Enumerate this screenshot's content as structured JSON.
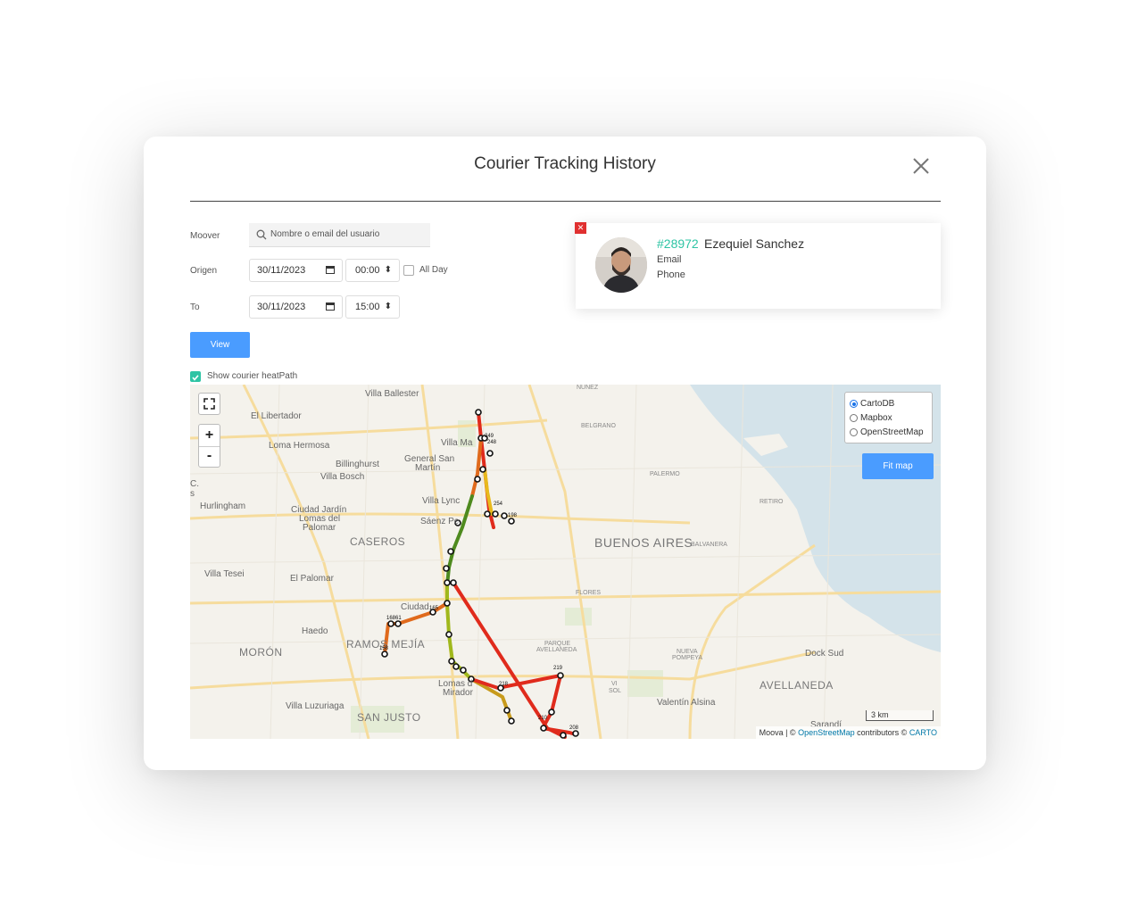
{
  "modal": {
    "title": "Courier Tracking History"
  },
  "form": {
    "moover_label": "Moover",
    "moover_placeholder": "Nombre o email del usuario",
    "origen_label": "Origen",
    "origen_date": "30/11/2023",
    "origen_time": "00:00",
    "all_day_label": "All Day",
    "to_label": "To",
    "to_date": "30/11/2023",
    "to_time": "15:00",
    "view_button": "View",
    "heatpath_label": "Show courier heatPath",
    "heatpath_checked": true
  },
  "courier": {
    "id": "#28972",
    "name": "Ezequiel Sanchez",
    "email": "Email",
    "phone": "Phone"
  },
  "map": {
    "zoom_in": "+",
    "zoom_out": "-",
    "layers": [
      "CartoDB",
      "Mapbox",
      "OpenStreetMap"
    ],
    "selected_layer": "CartoDB",
    "fit_button": "Fit map",
    "scale": "3 km",
    "attribution": {
      "prefix": "Moova | ©",
      "osm": "OpenStreetMap",
      "middle": "contributors ©",
      "carto": "CARTO"
    },
    "places": {
      "villa_ballester": "Villa Ballester",
      "nunez": "NUÑEZ",
      "el_libertador": "El Libertador",
      "belgrano": "BELGRANO",
      "loma_hermosa": "Loma Hermosa",
      "villa_maipu": "Villa Ma",
      "general_san_martin_1": "General San",
      "general_san_martin_2": "Martín",
      "billinghurst": "Billinghurst",
      "villa_bosch": "Villa Bosch",
      "palermo": "PALERMO",
      "hurlingham": "Hurlingham",
      "ciudad_jardin_1": "Ciudad Jardín",
      "ciudad_jardin_2": "Lomas del",
      "ciudad_jardin_3": "Palomar",
      "villa_lynch": "Villa Lync",
      "saenz_pena": "Sáenz Pe",
      "retiro": "RETIRO",
      "caseros": "CASEROS",
      "buenos_aires": "BUENOS AIRES",
      "balvanera": "BALVANERA",
      "villa_tesei": "Villa Tesei",
      "el_palomar": "El Palomar",
      "flores": "FLORES",
      "ciudad": "Ciudad",
      "haedo": "Haedo",
      "ramos_mejia": "RAMOS MEJÍA",
      "moron": "MORÓN",
      "parque_avellaneda_1": "PARQUE",
      "parque_avellaneda_2": "AVELLANEDA",
      "nueva_pompeya_1": "NUEVA",
      "nueva_pompeya_2": "POMPEYA",
      "dock_sud": "Dock Sud",
      "lomas_mirador_1": "Lomas d",
      "lomas_mirador_2": "Mirador",
      "avellaneda": "AVELLANEDA",
      "villa_luzuriaga": "Villa Luzuriaga",
      "san_justo": "SAN JUSTO",
      "valentin_alsina": "Valentín Alsina",
      "c_partial": "C.",
      "s_partial": "s",
      "vi_sol_1": "VI",
      "vi_sol_2": "SOL",
      "sarandi": "Sarandí"
    },
    "point_labels": {
      "p158": "158",
      "p164": "16861",
      "p210": "210",
      "p218": "218",
      "p219": "219",
      "p208": "208",
      "p165": "165",
      "p198": "198",
      "p254": "254",
      "p249": "249",
      "p248": "248"
    }
  }
}
